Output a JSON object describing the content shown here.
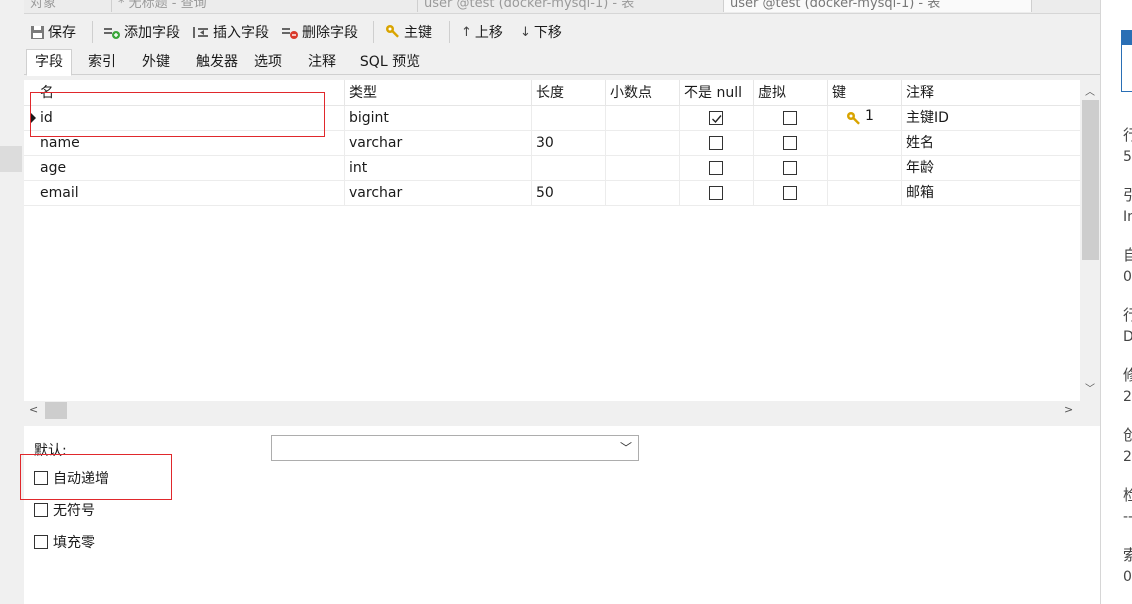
{
  "window_tabs": [
    "对象",
    "* 无标题 - 查询",
    "user @test (docker-mysql-1) - 表",
    "user @test (docker-mysql-1) - 表"
  ],
  "toolbar": {
    "save": "保存",
    "add_field": "添加字段",
    "insert_field": "插入字段",
    "delete_field": "删除字段",
    "primary_key": "主键",
    "move_up": "上移",
    "move_down": "下移"
  },
  "subtabs": [
    "字段",
    "索引",
    "外键",
    "触发器",
    "选项",
    "注释",
    "SQL 预览"
  ],
  "grid": {
    "columns": [
      "名",
      "类型",
      "长度",
      "小数点",
      "不是 null",
      "虚拟",
      "键",
      "注释"
    ],
    "rows": [
      {
        "name": "id",
        "type": "bigint",
        "length": "",
        "decimals": "",
        "not_null": true,
        "virtual": false,
        "key": "1",
        "comment": "主键ID"
      },
      {
        "name": "name",
        "type": "varchar",
        "length": "30",
        "decimals": "",
        "not_null": false,
        "virtual": false,
        "key": "",
        "comment": "姓名"
      },
      {
        "name": "age",
        "type": "int",
        "length": "",
        "decimals": "",
        "not_null": false,
        "virtual": false,
        "key": "",
        "comment": "年龄"
      },
      {
        "name": "email",
        "type": "varchar",
        "length": "50",
        "decimals": "",
        "not_null": false,
        "virtual": false,
        "key": "",
        "comment": "邮箱"
      }
    ]
  },
  "props": {
    "default_label": "默认:",
    "default_value": "",
    "auto_increment": "自动递增",
    "unsigned": "无符号",
    "zerofill": "填充零"
  },
  "side_panel": [
    "行",
    "5",
    "引",
    "In",
    "自",
    "0",
    "行",
    "D",
    "修",
    "2",
    "创",
    "2",
    "检",
    "--",
    "索",
    "0"
  ],
  "colors": {
    "annotation": "#e0282c",
    "key_icon": "#d9a400",
    "accent": "#2a6fb5"
  }
}
